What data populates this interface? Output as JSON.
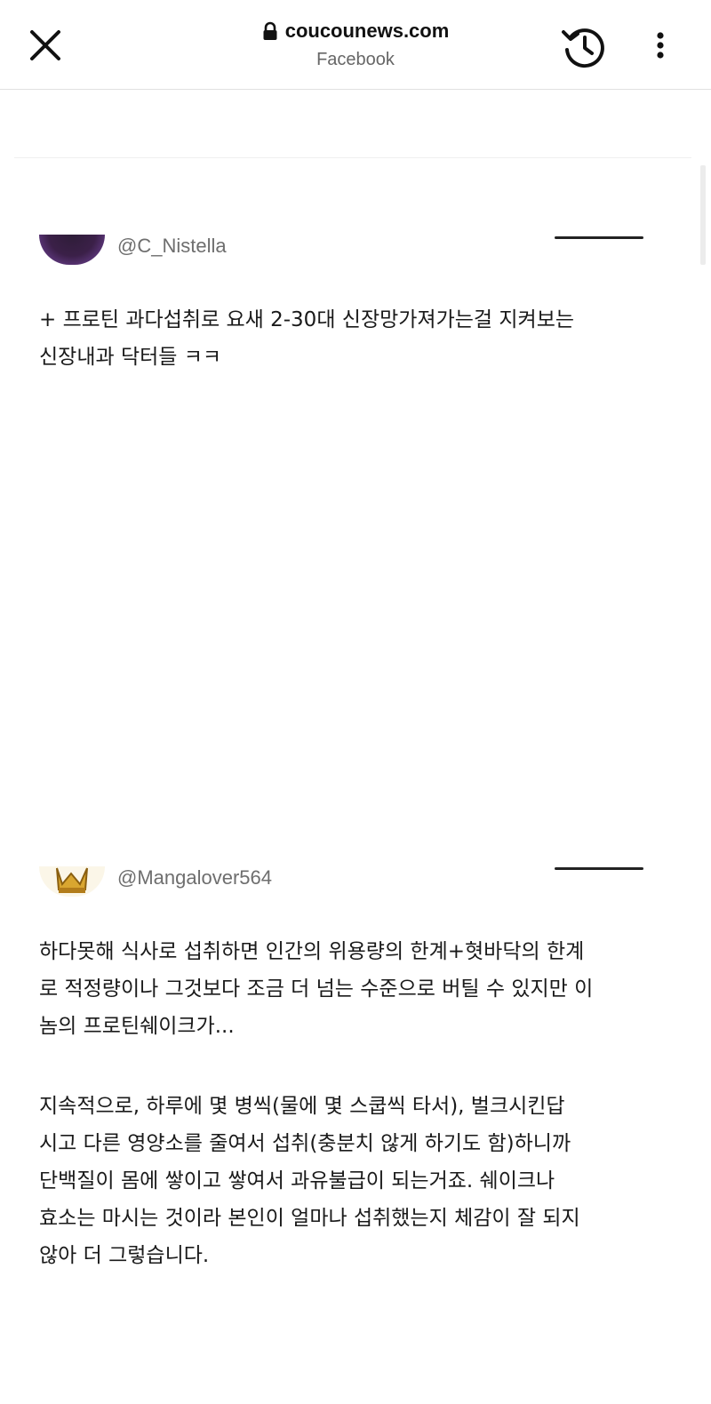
{
  "browser": {
    "domain": "coucounews.com",
    "subtitle": "Facebook",
    "close_icon": "close-icon",
    "lock_icon": "lock-icon",
    "history_icon": "history-icon",
    "more_icon": "more-vertical-icon"
  },
  "posts": [
    {
      "handle": "@C_Nistella",
      "lines": [
        "+ 프로틴 과다섭취로 요새 2-30대 신장망가져가는걸 지켜보는",
        "신장내과 닥터들 ㅋㅋ"
      ]
    },
    {
      "handle": "@Mangalover564",
      "lines": [
        "하다못해 식사로 섭취하면 인간의 위용량의 한계+혓바닥의 한계",
        "로 적정량이나 그것보다 조금 더 넘는 수준으로 버틸 수 있지만 이",
        "놈의 프로틴쉐이크가..."
      ],
      "lines2": [
        "지속적으로, 하루에 몇 병씩(물에 몇 스쿱씩 타서), 벌크시킨답",
        "시고 다른 영양소를 줄여서 섭취(충분치 않게 하기도 함)하니까",
        "단백질이 몸에 쌓이고 쌓여서 과유불급이 되는거죠. 쉐이크나",
        "효소는 마시는 것이라 본인이 얼마나 섭취했는지 체감이 잘 되지",
        "않아 더 그렇습니다."
      ]
    }
  ]
}
